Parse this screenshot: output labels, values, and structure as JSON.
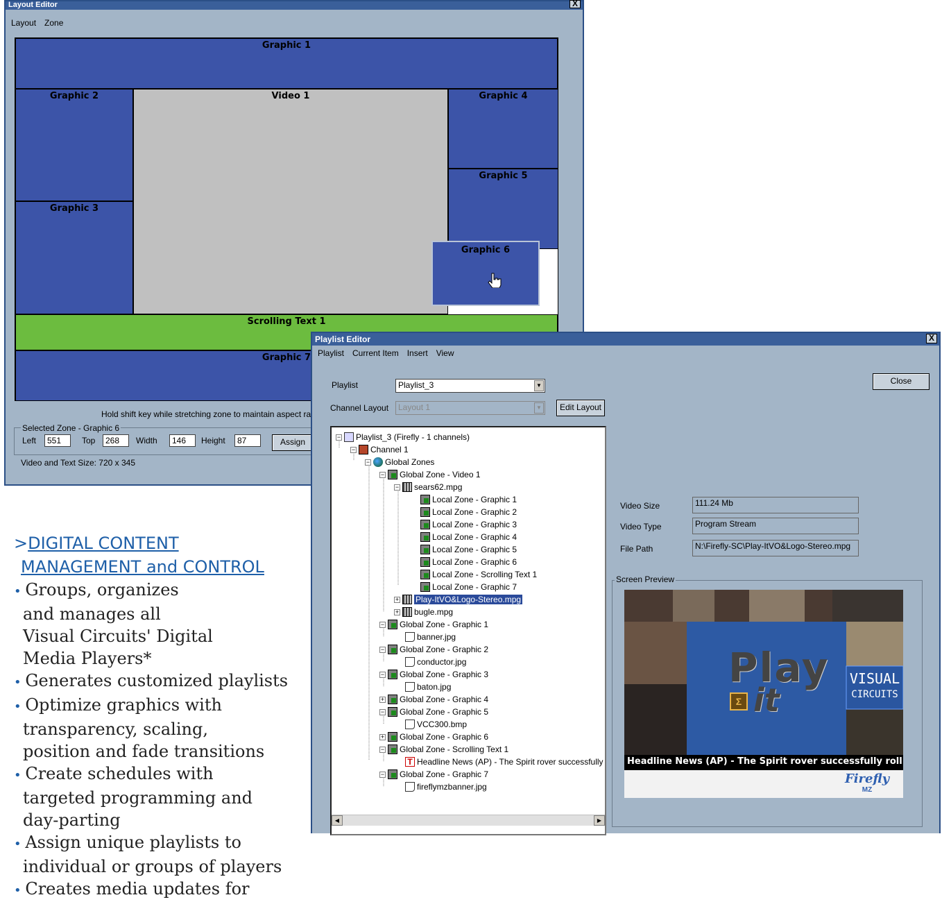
{
  "layout_editor": {
    "title": "Layout Editor",
    "close_label": "X",
    "menu": [
      "Layout",
      "Zone"
    ],
    "zones": {
      "graphic1": "Graphic 1",
      "graphic2": "Graphic 2",
      "graphic3": "Graphic 3",
      "video1": "Video 1",
      "graphic4": "Graphic 4",
      "graphic5": "Graphic 5",
      "graphic6": "Graphic 6",
      "scrolling_text1": "Scrolling Text 1",
      "graphic7": "Graphic 7"
    },
    "hint": "Hold shift key while stretching zone to maintain aspect ratio",
    "selected_zone_label": "Selected Zone - Graphic 6",
    "left_label": "Left",
    "left_value": "551",
    "top_label": "Top",
    "top_value": "268",
    "width_label": "Width",
    "width_value": "146",
    "height_label": "Height",
    "height_value": "87",
    "assign_label": "Assign",
    "size_info": "Video and Text Size: 720 x 345"
  },
  "playlist_editor": {
    "title": "Playlist Editor",
    "close_x": "X",
    "menu": [
      "Playlist",
      "Current Item",
      "Insert",
      "View"
    ],
    "playlist_label": "Playlist",
    "playlist_value": "Playlist_3",
    "channel_layout_label": "Channel Layout",
    "channel_layout_value": "Layout 1",
    "edit_layout_label": "Edit Layout",
    "close_label": "Close",
    "tree": [
      "Playlist_3  (Firefly - 1 channels)",
      "Channel 1",
      "Global Zones",
      "Global Zone - Video 1",
      "sears62.mpg",
      "Local Zone - Graphic 1",
      "Local Zone - Graphic 2",
      "Local Zone - Graphic 3",
      "Local Zone - Graphic 4",
      "Local Zone - Graphic 5",
      "Local Zone - Graphic 6",
      "Local Zone - Scrolling Text 1",
      "Local Zone - Graphic 7",
      "Play-ItVO&Logo-Stereo.mpg",
      "bugle.mpg",
      "Global Zone - Graphic 1",
      "banner.jpg",
      "Global Zone - Graphic 2",
      "conductor.jpg",
      "Global Zone - Graphic 3",
      "baton.jpg",
      "Global Zone - Graphic 4",
      "Global Zone - Graphic 5",
      "VCC300.bmp",
      "Global Zone - Graphic 6",
      "Global Zone - Scrolling Text 1",
      "Headline News (AP) - The Spirit rover successfully",
      "Global Zone - Graphic 7",
      "fireflymzbanner.jpg"
    ],
    "video_size_label": "Video Size",
    "video_size_value": "111.24 Mb",
    "video_type_label": "Video Type",
    "video_type_value": "Program Stream",
    "file_path_label": "File Path",
    "file_path_value": "N:\\Firefly-SC\\Play-ItVO&Logo-Stereo.mpg",
    "screen_preview_label": "Screen Preview",
    "preview": {
      "play_text": "Play",
      "it_text": "it",
      "visual_text": "VISUAL",
      "circuits_text": "CIRCUITS",
      "ticker": "Headline News (AP) - The Spirit rover successfully roll",
      "firefly_logo": "Firefly",
      "mz_text": "MZ"
    }
  },
  "marketing": {
    "heading_prefix": ">",
    "heading_line1": "DIGITAL CONTENT ",
    "heading_line2": "MANAGEMENT and CONTROL",
    "bullets": [
      "Groups, organizes and manages all Visual Circuits' Digital Media Players*",
      "Generates customized playlists",
      "Optimize graphics with transparency, scaling, position and fade transitions",
      "Create schedules with targeted programming and day-parting",
      "Assign unique playlists to individual or groups of players",
      "Creates media updates for"
    ]
  },
  "colors": {
    "window_bg": "#a3b5c7",
    "zone_blue": "#3c54a8",
    "zone_gray": "#c0c0c0",
    "zone_green": "#6cbc3f",
    "title_bar": "#3a5f9a",
    "heading_blue": "#1e5fa8"
  }
}
